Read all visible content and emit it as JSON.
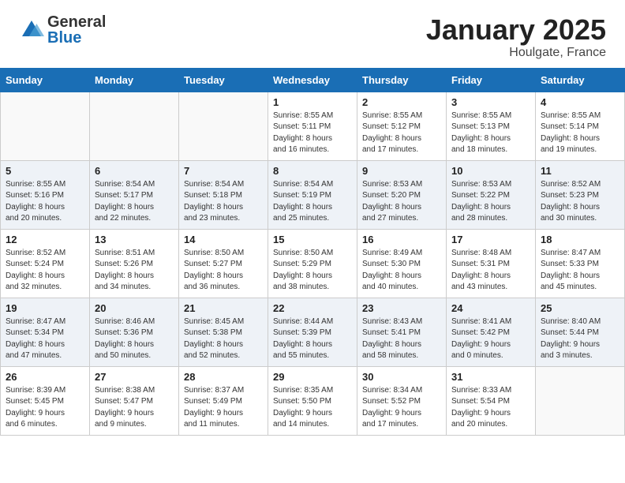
{
  "header": {
    "logo_general": "General",
    "logo_blue": "Blue",
    "month": "January 2025",
    "location": "Houlgate, France"
  },
  "days_of_week": [
    "Sunday",
    "Monday",
    "Tuesday",
    "Wednesday",
    "Thursday",
    "Friday",
    "Saturday"
  ],
  "weeks": [
    [
      {
        "day": "",
        "info": ""
      },
      {
        "day": "",
        "info": ""
      },
      {
        "day": "",
        "info": ""
      },
      {
        "day": "1",
        "info": "Sunrise: 8:55 AM\nSunset: 5:11 PM\nDaylight: 8 hours\nand 16 minutes."
      },
      {
        "day": "2",
        "info": "Sunrise: 8:55 AM\nSunset: 5:12 PM\nDaylight: 8 hours\nand 17 minutes."
      },
      {
        "day": "3",
        "info": "Sunrise: 8:55 AM\nSunset: 5:13 PM\nDaylight: 8 hours\nand 18 minutes."
      },
      {
        "day": "4",
        "info": "Sunrise: 8:55 AM\nSunset: 5:14 PM\nDaylight: 8 hours\nand 19 minutes."
      }
    ],
    [
      {
        "day": "5",
        "info": "Sunrise: 8:55 AM\nSunset: 5:16 PM\nDaylight: 8 hours\nand 20 minutes."
      },
      {
        "day": "6",
        "info": "Sunrise: 8:54 AM\nSunset: 5:17 PM\nDaylight: 8 hours\nand 22 minutes."
      },
      {
        "day": "7",
        "info": "Sunrise: 8:54 AM\nSunset: 5:18 PM\nDaylight: 8 hours\nand 23 minutes."
      },
      {
        "day": "8",
        "info": "Sunrise: 8:54 AM\nSunset: 5:19 PM\nDaylight: 8 hours\nand 25 minutes."
      },
      {
        "day": "9",
        "info": "Sunrise: 8:53 AM\nSunset: 5:20 PM\nDaylight: 8 hours\nand 27 minutes."
      },
      {
        "day": "10",
        "info": "Sunrise: 8:53 AM\nSunset: 5:22 PM\nDaylight: 8 hours\nand 28 minutes."
      },
      {
        "day": "11",
        "info": "Sunrise: 8:52 AM\nSunset: 5:23 PM\nDaylight: 8 hours\nand 30 minutes."
      }
    ],
    [
      {
        "day": "12",
        "info": "Sunrise: 8:52 AM\nSunset: 5:24 PM\nDaylight: 8 hours\nand 32 minutes."
      },
      {
        "day": "13",
        "info": "Sunrise: 8:51 AM\nSunset: 5:26 PM\nDaylight: 8 hours\nand 34 minutes."
      },
      {
        "day": "14",
        "info": "Sunrise: 8:50 AM\nSunset: 5:27 PM\nDaylight: 8 hours\nand 36 minutes."
      },
      {
        "day": "15",
        "info": "Sunrise: 8:50 AM\nSunset: 5:29 PM\nDaylight: 8 hours\nand 38 minutes."
      },
      {
        "day": "16",
        "info": "Sunrise: 8:49 AM\nSunset: 5:30 PM\nDaylight: 8 hours\nand 40 minutes."
      },
      {
        "day": "17",
        "info": "Sunrise: 8:48 AM\nSunset: 5:31 PM\nDaylight: 8 hours\nand 43 minutes."
      },
      {
        "day": "18",
        "info": "Sunrise: 8:47 AM\nSunset: 5:33 PM\nDaylight: 8 hours\nand 45 minutes."
      }
    ],
    [
      {
        "day": "19",
        "info": "Sunrise: 8:47 AM\nSunset: 5:34 PM\nDaylight: 8 hours\nand 47 minutes."
      },
      {
        "day": "20",
        "info": "Sunrise: 8:46 AM\nSunset: 5:36 PM\nDaylight: 8 hours\nand 50 minutes."
      },
      {
        "day": "21",
        "info": "Sunrise: 8:45 AM\nSunset: 5:38 PM\nDaylight: 8 hours\nand 52 minutes."
      },
      {
        "day": "22",
        "info": "Sunrise: 8:44 AM\nSunset: 5:39 PM\nDaylight: 8 hours\nand 55 minutes."
      },
      {
        "day": "23",
        "info": "Sunrise: 8:43 AM\nSunset: 5:41 PM\nDaylight: 8 hours\nand 58 minutes."
      },
      {
        "day": "24",
        "info": "Sunrise: 8:41 AM\nSunset: 5:42 PM\nDaylight: 9 hours\nand 0 minutes."
      },
      {
        "day": "25",
        "info": "Sunrise: 8:40 AM\nSunset: 5:44 PM\nDaylight: 9 hours\nand 3 minutes."
      }
    ],
    [
      {
        "day": "26",
        "info": "Sunrise: 8:39 AM\nSunset: 5:45 PM\nDaylight: 9 hours\nand 6 minutes."
      },
      {
        "day": "27",
        "info": "Sunrise: 8:38 AM\nSunset: 5:47 PM\nDaylight: 9 hours\nand 9 minutes."
      },
      {
        "day": "28",
        "info": "Sunrise: 8:37 AM\nSunset: 5:49 PM\nDaylight: 9 hours\nand 11 minutes."
      },
      {
        "day": "29",
        "info": "Sunrise: 8:35 AM\nSunset: 5:50 PM\nDaylight: 9 hours\nand 14 minutes."
      },
      {
        "day": "30",
        "info": "Sunrise: 8:34 AM\nSunset: 5:52 PM\nDaylight: 9 hours\nand 17 minutes."
      },
      {
        "day": "31",
        "info": "Sunrise: 8:33 AM\nSunset: 5:54 PM\nDaylight: 9 hours\nand 20 minutes."
      },
      {
        "day": "",
        "info": ""
      }
    ]
  ]
}
